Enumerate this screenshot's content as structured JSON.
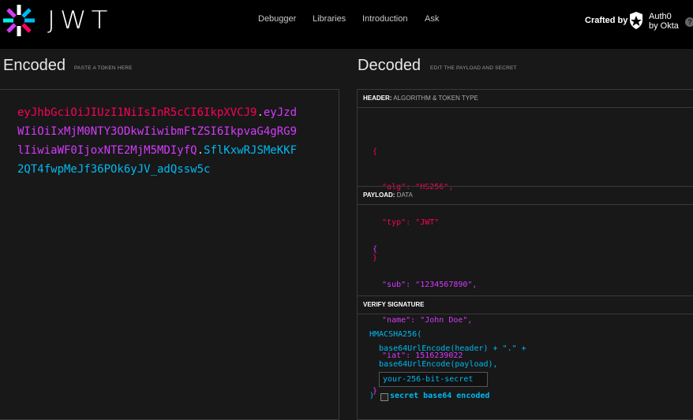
{
  "nav": {
    "logo_text": "JWT",
    "items": [
      "Debugger",
      "Libraries",
      "Introduction",
      "Ask"
    ],
    "crafted_by": "Crafted by",
    "brand_line1": "Auth0",
    "brand_line2": "by Okta",
    "help": "?"
  },
  "encoded": {
    "title": "Encoded",
    "subtitle": "PASTE A TOKEN HERE",
    "token_header": "eyJhbGciOiJIUzI1NiIsInR5cCI6IkpXVCJ9",
    "token_payload": "eyJzdWIiOiIxMjM0NTY3ODkwIiwibmFtZSI6IkpvaG4gRG9lIiwiaWF0IjoxNTE2MjM5MDIyfQ",
    "token_signature": "SflKxwRJSMeKKF2QT4fwpMeJf36POk6yJV_adQssw5c",
    "dot": "."
  },
  "decoded": {
    "title": "Decoded",
    "subtitle": "EDIT THE PAYLOAD AND SECRET",
    "header_label": "HEADER:",
    "header_desc": "ALGORITHM & TOKEN TYPE",
    "header_lines": [
      "{",
      "  \"alg\": \"HS256\",",
      "  \"typ\": \"JWT\"",
      "}"
    ],
    "payload_label": "PAYLOAD:",
    "payload_desc": "DATA",
    "payload_lines": [
      "{",
      "  \"sub\": \"1234567890\",",
      "  \"name\": \"John Doe\",",
      "  \"iat\": 1516239022",
      "}"
    ],
    "verify_label": "VERIFY SIGNATURE",
    "sig_fn": "HMACSHA256(",
    "sig_line1": "  base64UrlEncode(header) + \".\" +",
    "sig_line2": "  base64UrlEncode(payload),",
    "secret_value": "your-256-bit-secret",
    "sig_close": ")",
    "b64_label": "secret base64 encoded"
  },
  "colors": {
    "header": "#fb015b",
    "payload": "#d63aff",
    "signature": "#00b9f1"
  }
}
